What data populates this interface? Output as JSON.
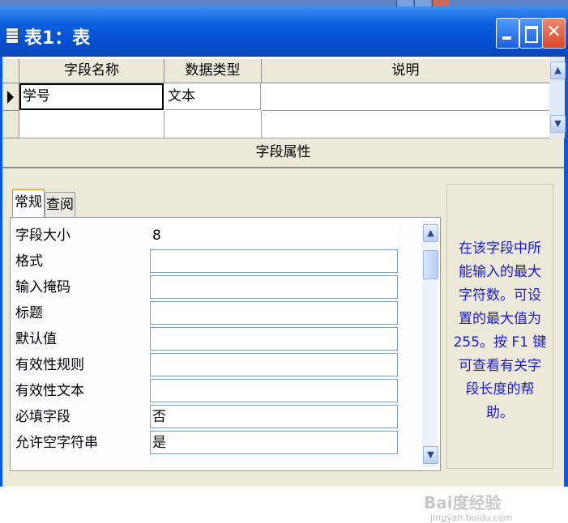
{
  "window": {
    "title": "表1：表",
    "buttons": {
      "minimize": "_",
      "maximize": "□",
      "close": "X"
    }
  },
  "grid": {
    "headers": [
      "字段名称",
      "数据类型",
      "说明"
    ],
    "rows": [
      {
        "name": "学号",
        "type": "文本",
        "desc": ""
      },
      {
        "name": "",
        "type": "",
        "desc": ""
      }
    ]
  },
  "section_title": "字段属性",
  "tabs": [
    "常规",
    "查阅"
  ],
  "properties": [
    {
      "label": "字段大小",
      "value": "8"
    },
    {
      "label": "格式",
      "value": ""
    },
    {
      "label": "输入掩码",
      "value": ""
    },
    {
      "label": "标题",
      "value": ""
    },
    {
      "label": "默认值",
      "value": ""
    },
    {
      "label": "有效性规则",
      "value": ""
    },
    {
      "label": "有效性文本",
      "value": ""
    },
    {
      "label": "必填字段",
      "value": "否"
    },
    {
      "label": "允许空字符串",
      "value": "是"
    }
  ],
  "help_text": "在该字段中所能输入的最大字符数。可设置的最大值为 255。按 F1 键可查看有关字段长度的帮助。",
  "watermark": {
    "brand": "Bai度经验",
    "url": "jingyan.baidu.com"
  },
  "colors": {
    "titlebar": "#0a5fe0",
    "client": "#ece9d8",
    "help_text": "#1a1ad8",
    "tab_accent": "#f3b33d"
  }
}
